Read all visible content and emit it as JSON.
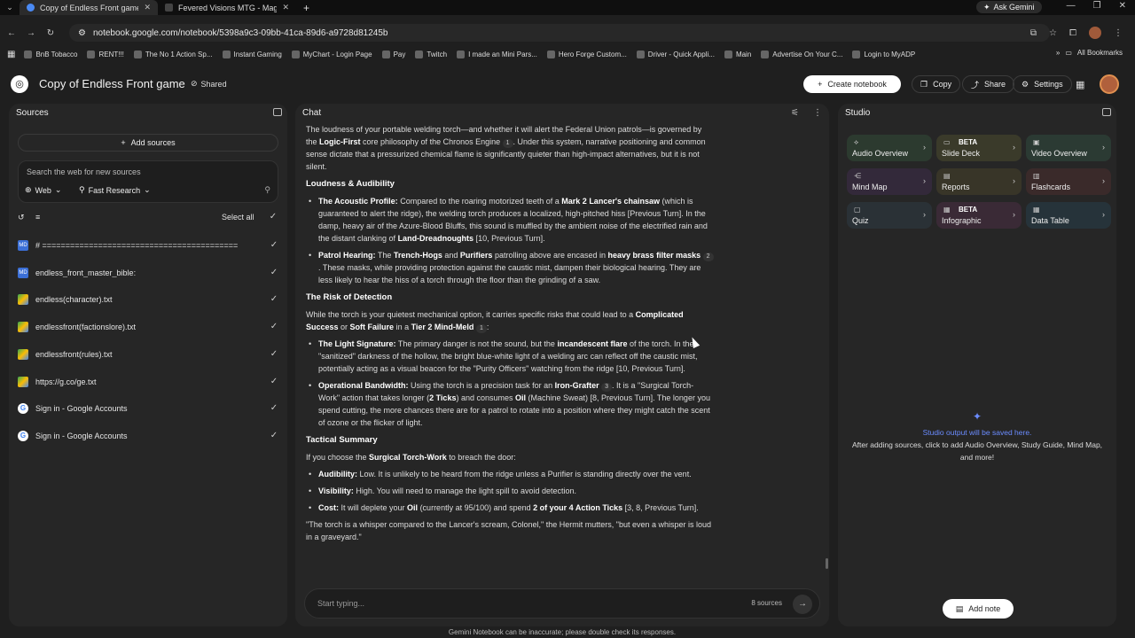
{
  "browser": {
    "tabs": [
      {
        "title": "Copy of Endless Front game - G",
        "active": true
      },
      {
        "title": "Fevered Visions MTG - Magic: T",
        "active": false
      }
    ],
    "ask_gemini": "Ask Gemini",
    "url": "notebook.google.com/notebook/5398a9c3-09bb-41ca-89d6-a9728d81245b",
    "bookmarks": [
      "BnB Tobacco",
      "RENT!!!",
      "The No 1 Action Sp...",
      "Instant Gaming",
      "MyChart - Login Page",
      "Pay",
      "Twitch",
      "I made an Mini Pars...",
      "Hero Forge Custom...",
      "Driver - Quick Appli...",
      "Main",
      "Advertise On Your C...",
      "Login to MyADP"
    ],
    "all_bookmarks": "All Bookmarks"
  },
  "header": {
    "title": "Copy of Endless Front game",
    "shared": "Shared",
    "create_notebook": "Create notebook",
    "copy": "Copy",
    "share": "Share",
    "settings": "Settings"
  },
  "sources": {
    "title": "Sources",
    "add_sources": "Add sources",
    "search_placeholder": "Search the web for new sources",
    "web_chip": "Web",
    "research_chip": "Fast Research",
    "select_all": "Select all",
    "items": [
      {
        "label": "# ==========================================",
        "icon": "md"
      },
      {
        "label": "endless_front_master_bible:",
        "icon": "md"
      },
      {
        "label": "endless(character).txt",
        "icon": "drive"
      },
      {
        "label": "endlessfront(factionslore).txt",
        "icon": "drive"
      },
      {
        "label": "endlessfront(rules).txt",
        "icon": "drive"
      },
      {
        "label": "https://g.co/ge.txt",
        "icon": "drive"
      },
      {
        "label": "Sign in - Google Accounts",
        "icon": "google"
      },
      {
        "label": "Sign in - Google Accounts",
        "icon": "google"
      }
    ]
  },
  "chat": {
    "title": "Chat",
    "intro": {
      "t1": "The loudness of your portable welding torch—and whether it will alert the Federal Union patrols—is governed by the ",
      "b1": "Logic-First",
      "t2": " core philosophy of the Chronos Engine ",
      "c1": "1",
      "t3": ". Under this system, narrative positioning and common sense dictate that a pressurized chemical flame is significantly quieter than high-impact alternatives, but it is not silent."
    },
    "h_loudness": "Loudness & Audibility",
    "acoustic": {
      "b": "The Acoustic Profile:",
      "t1": " Compared to the roaring motorized teeth of a ",
      "b2": "Mark 2 Lancer's chainsaw",
      "t2": " (which is guaranteed to alert the ridge), the welding torch produces a localized, high-pitched hiss [Previous Turn]. In the damp, heavy air of the Azure-Blood Bluffs, this sound is muffled by the ambient noise of the electrified rain and the distant clanking of ",
      "b3": "Land-Dreadnoughts",
      "t3": " [10, Previous Turn]."
    },
    "patrol": {
      "b": "Patrol Hearing:",
      "t1": " The ",
      "b2": "Trench-Hogs",
      "t2": " and ",
      "b3": "Purifiers",
      "t3": " patrolling above are encased in ",
      "b4": "heavy brass filter masks",
      "c": "2",
      "t4": ". These masks, while providing protection against the caustic mist, dampen their biological hearing. They are less likely to hear the hiss of a torch through the floor than the grinding of a saw."
    },
    "h_risk": "The Risk of Detection",
    "risk_intro": {
      "t1": "While the torch is your quietest mechanical option, it carries specific risks that could lead to a ",
      "b1": "Complicated Success",
      "t2": " or ",
      "b2": "Soft Failure",
      "t3": " in a ",
      "b3": "Tier 2 Mind-Meld",
      "c": "1",
      "t4": ":"
    },
    "light": {
      "b": "The Light Signature:",
      "t1": " The primary danger is not the sound, but the ",
      "b2": "incandescent flare",
      "t2": " of the torch. In the \"sanitized\" darkness of the hollow, the bright blue-white light of a welding arc can reflect off the caustic mist, potentially acting as a visual beacon for the \"Purity Officers\" watching from the ridge [10, Previous Turn]."
    },
    "bandwidth": {
      "b": "Operational Bandwidth:",
      "t1": " Using the torch is a precision task for an ",
      "b2": "Iron-Grafter",
      "c": "3",
      "t2": ". It is a \"Surgical Torch-Work\" action that takes longer (",
      "b3": "2 Ticks",
      "t3": ") and consumes ",
      "b4": "Oil",
      "t4": " (Machine Sweat) [8, Previous Turn]. The longer you spend cutting, the more chances there are for a patrol to rotate into a position where they might catch the scent of ozone or the flicker of light."
    },
    "h_summary": "Tactical Summary",
    "summary_intro": {
      "t1": "If you choose the ",
      "b1": "Surgical Torch-Work",
      "t2": " to breach the door:"
    },
    "audibility": {
      "b": "Audibility:",
      "t": " Low. It is unlikely to be heard from the ridge unless a Purifier is standing directly over the vent."
    },
    "visibility": {
      "b": "Visibility:",
      "t": " High. You will need to manage the light spill to avoid detection."
    },
    "cost": {
      "b": "Cost:",
      "t1": " It will deplete your ",
      "b2": "Oil",
      "t2": " (currently at 95/100) and spend ",
      "b3": "2 of your 4 Action Ticks",
      "t3": " [3, 8, Previous Turn]."
    },
    "quote": "\"The torch is a whisper compared to the Lancer's scream, Colonel,\" the Hermit mutters, \"but even a whisper is loud in a graveyard.\"",
    "input_placeholder": "Start typing...",
    "source_count": "8 sources",
    "disclaimer": "Gemini Notebook can be inaccurate; please double check its responses."
  },
  "studio": {
    "title": "Studio",
    "tiles": [
      {
        "label": "Audio Overview",
        "beta": "",
        "bg": "#2c3a2f"
      },
      {
        "label": "Slide Deck",
        "beta": "BETA",
        "bg": "#3a3a2a"
      },
      {
        "label": "Video Overview",
        "beta": "",
        "bg": "#2b3a33"
      },
      {
        "label": "Mind Map",
        "beta": "",
        "bg": "#33293a"
      },
      {
        "label": "Reports",
        "beta": "",
        "bg": "#383528"
      },
      {
        "label": "Flashcards",
        "beta": "",
        "bg": "#3a2a2a"
      },
      {
        "label": "Quiz",
        "beta": "",
        "bg": "#2a3136"
      },
      {
        "label": "Infographic",
        "beta": "BETA",
        "bg": "#3a2a36"
      },
      {
        "label": "Data Table",
        "beta": "",
        "bg": "#26333a"
      }
    ],
    "empty_title": "Studio output will be saved here.",
    "empty_body": "After adding sources, click to add Audio Overview, Study Guide, Mind Map, and more!",
    "add_note": "Add note"
  }
}
